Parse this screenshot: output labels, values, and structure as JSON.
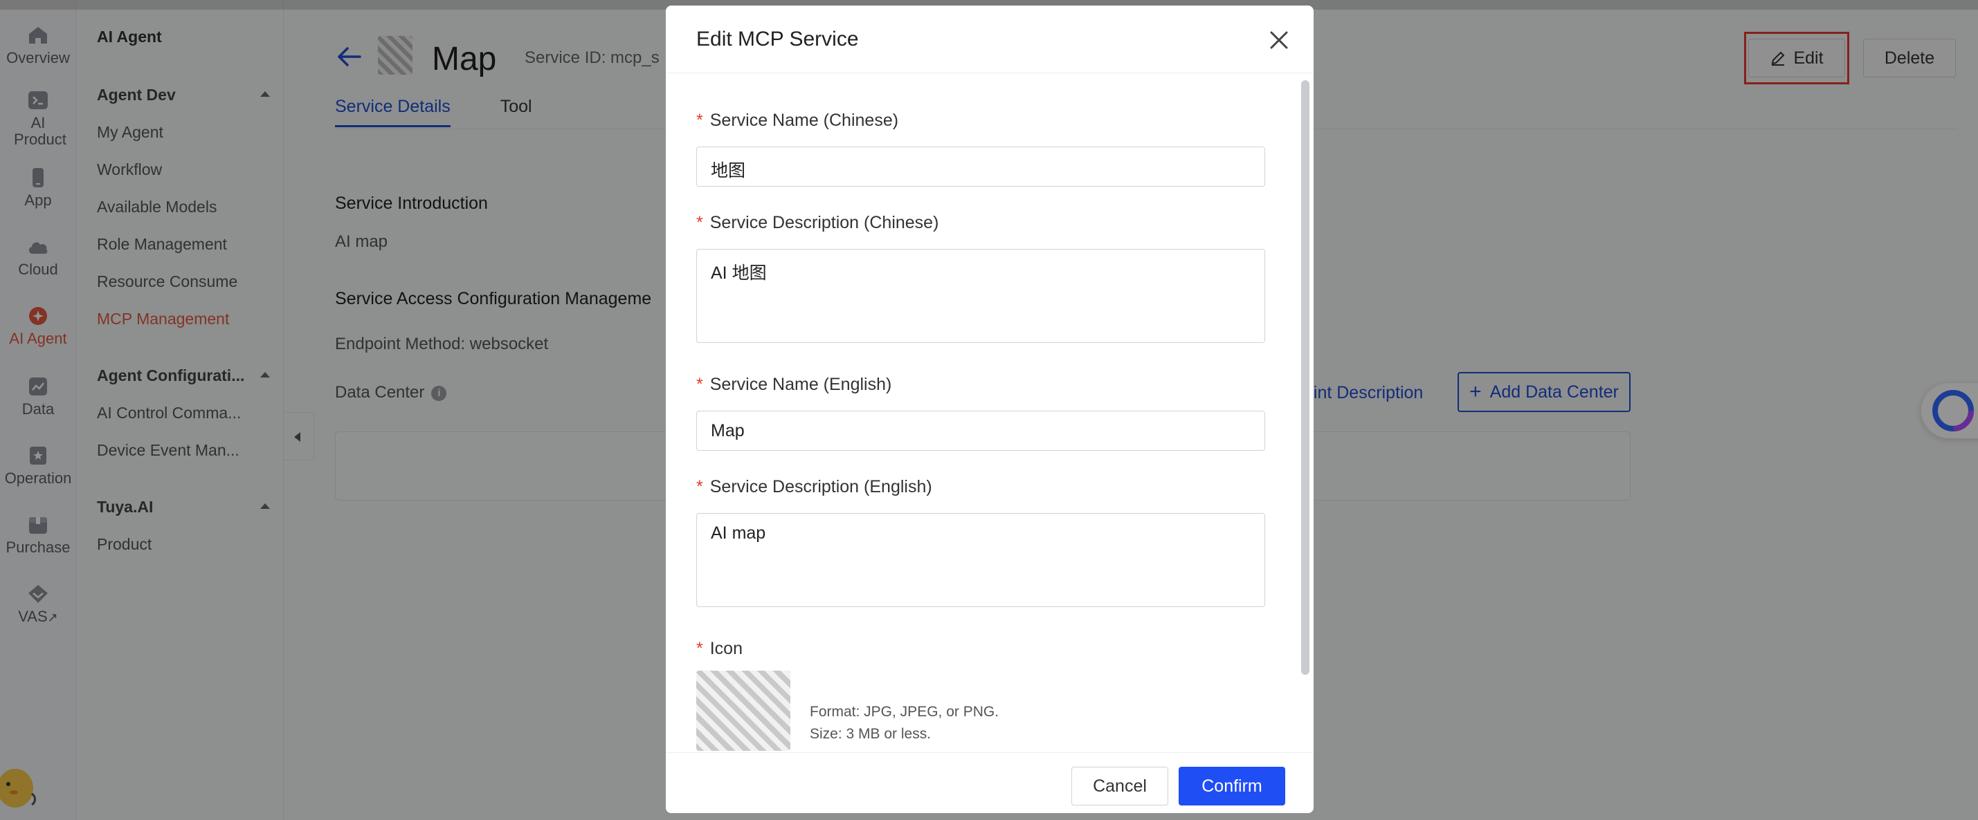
{
  "rail": {
    "items": [
      {
        "label": "Overview",
        "icon": "home-icon"
      },
      {
        "label": "AI Product",
        "icon": "terminal-icon"
      },
      {
        "label": "App",
        "icon": "phone-icon"
      },
      {
        "label": "Cloud",
        "icon": "cloud-icon"
      },
      {
        "label": "AI Agent",
        "icon": "agent-icon",
        "active": true
      },
      {
        "label": "Data",
        "icon": "chart-icon"
      },
      {
        "label": "Operation",
        "icon": "bookmark-icon"
      },
      {
        "label": "Purchase",
        "icon": "box-icon"
      },
      {
        "label": "VAS",
        "icon": "diamond-icon"
      }
    ],
    "vas_arrow": "↗"
  },
  "sidebar": {
    "title": "AI Agent",
    "groups": [
      {
        "label": "Agent Dev",
        "items": [
          "My Agent",
          "Workflow",
          "Available Models",
          "Role Management",
          "Resource Consume",
          "MCP Management"
        ]
      },
      {
        "label": "Agent Configurati...",
        "items": [
          "AI Control Comma...",
          "Device Event Man..."
        ]
      },
      {
        "label": "Tuya.AI",
        "items": [
          "Product"
        ]
      }
    ],
    "active_item": "MCP Management"
  },
  "header": {
    "service_name": "Map",
    "service_id": "Service ID: mcp_s",
    "edit_label": "Edit",
    "delete_label": "Delete"
  },
  "tabs": [
    {
      "label": "Service Details",
      "active": true
    },
    {
      "label": "Tool",
      "active": false
    }
  ],
  "details": {
    "intro_title": "Service Introduction",
    "intro_text": "AI map",
    "access_title": "Service Access Configuration Manageme",
    "endpoint_method": "Endpoint Method: websocket",
    "data_center_label": "Data Center",
    "info_glyph": "i",
    "endpoint_desc_link": "oint Description",
    "add_data_center": "Add Data Center",
    "add_glyph": "+"
  },
  "modal": {
    "title": "Edit MCP Service",
    "required_mark": "*",
    "fields": {
      "name_cn_label": "Service Name (Chinese)",
      "name_cn_value": "地图",
      "desc_cn_label": "Service Description (Chinese)",
      "desc_cn_value": "AI 地图",
      "name_en_label": "Service Name (English)",
      "name_en_value": "Map",
      "desc_en_label": "Service Description (English)",
      "desc_en_value": "AI map",
      "icon_label": "Icon",
      "icon_format": "Format: JPG, JPEG, or PNG.",
      "icon_size": "Size: 3 MB or less."
    },
    "cancel_label": "Cancel",
    "confirm_label": "Confirm"
  },
  "colors": {
    "accent": "#1f4ef5",
    "active_nav": "#e2583e",
    "highlight": "#e63b2e"
  }
}
